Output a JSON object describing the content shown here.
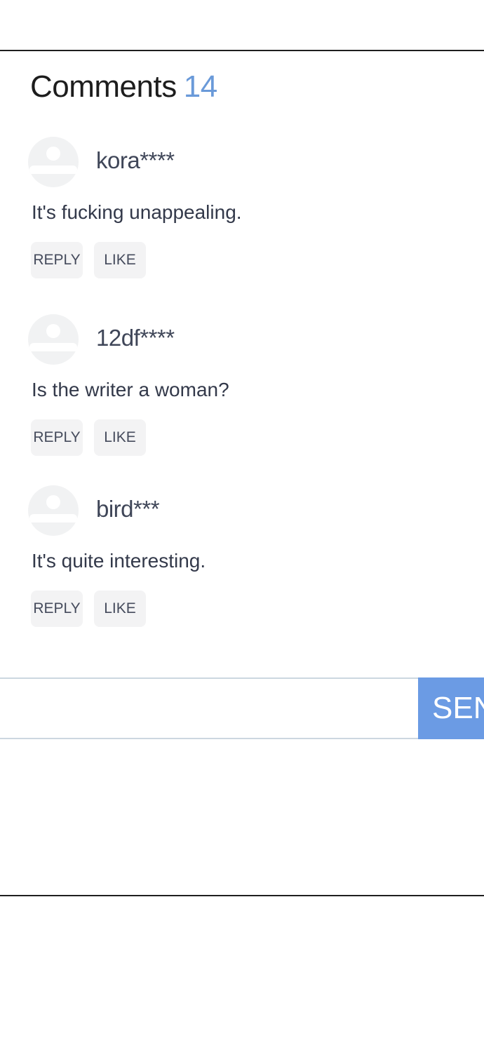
{
  "header": {
    "title": "Comments",
    "count": "14"
  },
  "comments": [
    {
      "username": "kora****",
      "text": "It's fucking unappealing.",
      "reply_label": "REPLY",
      "like_label": "LIKE"
    },
    {
      "username": "12df****",
      "text": "Is the writer a woman?",
      "reply_label": "REPLY",
      "like_label": "LIKE"
    },
    {
      "username": "bird***",
      "text": "It's quite interesting.",
      "reply_label": "REPLY",
      "like_label": "LIKE"
    }
  ],
  "comment_form": {
    "input_value": "",
    "send_label": "SEN"
  },
  "colors": {
    "accent": "#6b9be4",
    "count": "#6a9ad9",
    "button_bg": "#f3f3f4",
    "avatar_bg": "#f1f2f3"
  },
  "icons": {
    "avatar": "user-avatar-placeholder-icon"
  }
}
